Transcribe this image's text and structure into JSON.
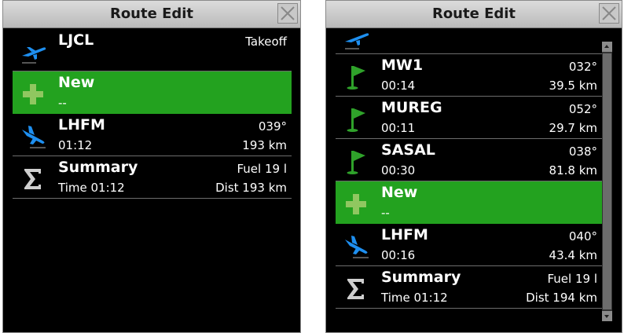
{
  "left_panel": {
    "title": "Route Edit",
    "rows": [
      {
        "icon": "takeoff-icon",
        "name": "LJCL",
        "sub": "",
        "right_top": "Takeoff",
        "right_bottom": ""
      },
      {
        "icon": "plus-icon",
        "name": "New",
        "sub": "--",
        "right_top": "",
        "right_bottom": ""
      },
      {
        "icon": "landing-icon",
        "name": "LHFM",
        "sub": "01:12",
        "right_top": "039°",
        "right_bottom": "193 km"
      },
      {
        "icon": "sigma-icon",
        "name": "Summary",
        "sub": "Time 01:12",
        "right_top": "Fuel 19 l",
        "right_bottom": "Dist 193 km"
      }
    ]
  },
  "right_panel": {
    "title": "Route Edit",
    "rows": [
      {
        "icon": "flag-icon",
        "name": "MW1",
        "sub": "00:14",
        "right_top": "032°",
        "right_bottom": "39.5 km"
      },
      {
        "icon": "flag-icon",
        "name": "MUREG",
        "sub": "00:11",
        "right_top": "052°",
        "right_bottom": "29.7 km"
      },
      {
        "icon": "flag-icon",
        "name": "SASAL",
        "sub": "00:30",
        "right_top": "038°",
        "right_bottom": "81.8 km"
      },
      {
        "icon": "plus-icon",
        "name": "New",
        "sub": "--",
        "right_top": "",
        "right_bottom": ""
      },
      {
        "icon": "landing-icon",
        "name": "LHFM",
        "sub": "00:16",
        "right_top": "040°",
        "right_bottom": "43.4 km"
      },
      {
        "icon": "sigma-icon",
        "name": "Summary",
        "sub": "Time 01:12",
        "right_top": "Fuel 19 l",
        "right_bottom": "Dist 194 km"
      }
    ]
  },
  "colors": {
    "selected": "#23a21f",
    "icon_blue": "#1e8ff0",
    "flag_green": "#2fa22a",
    "plus_green": "#90c760"
  }
}
